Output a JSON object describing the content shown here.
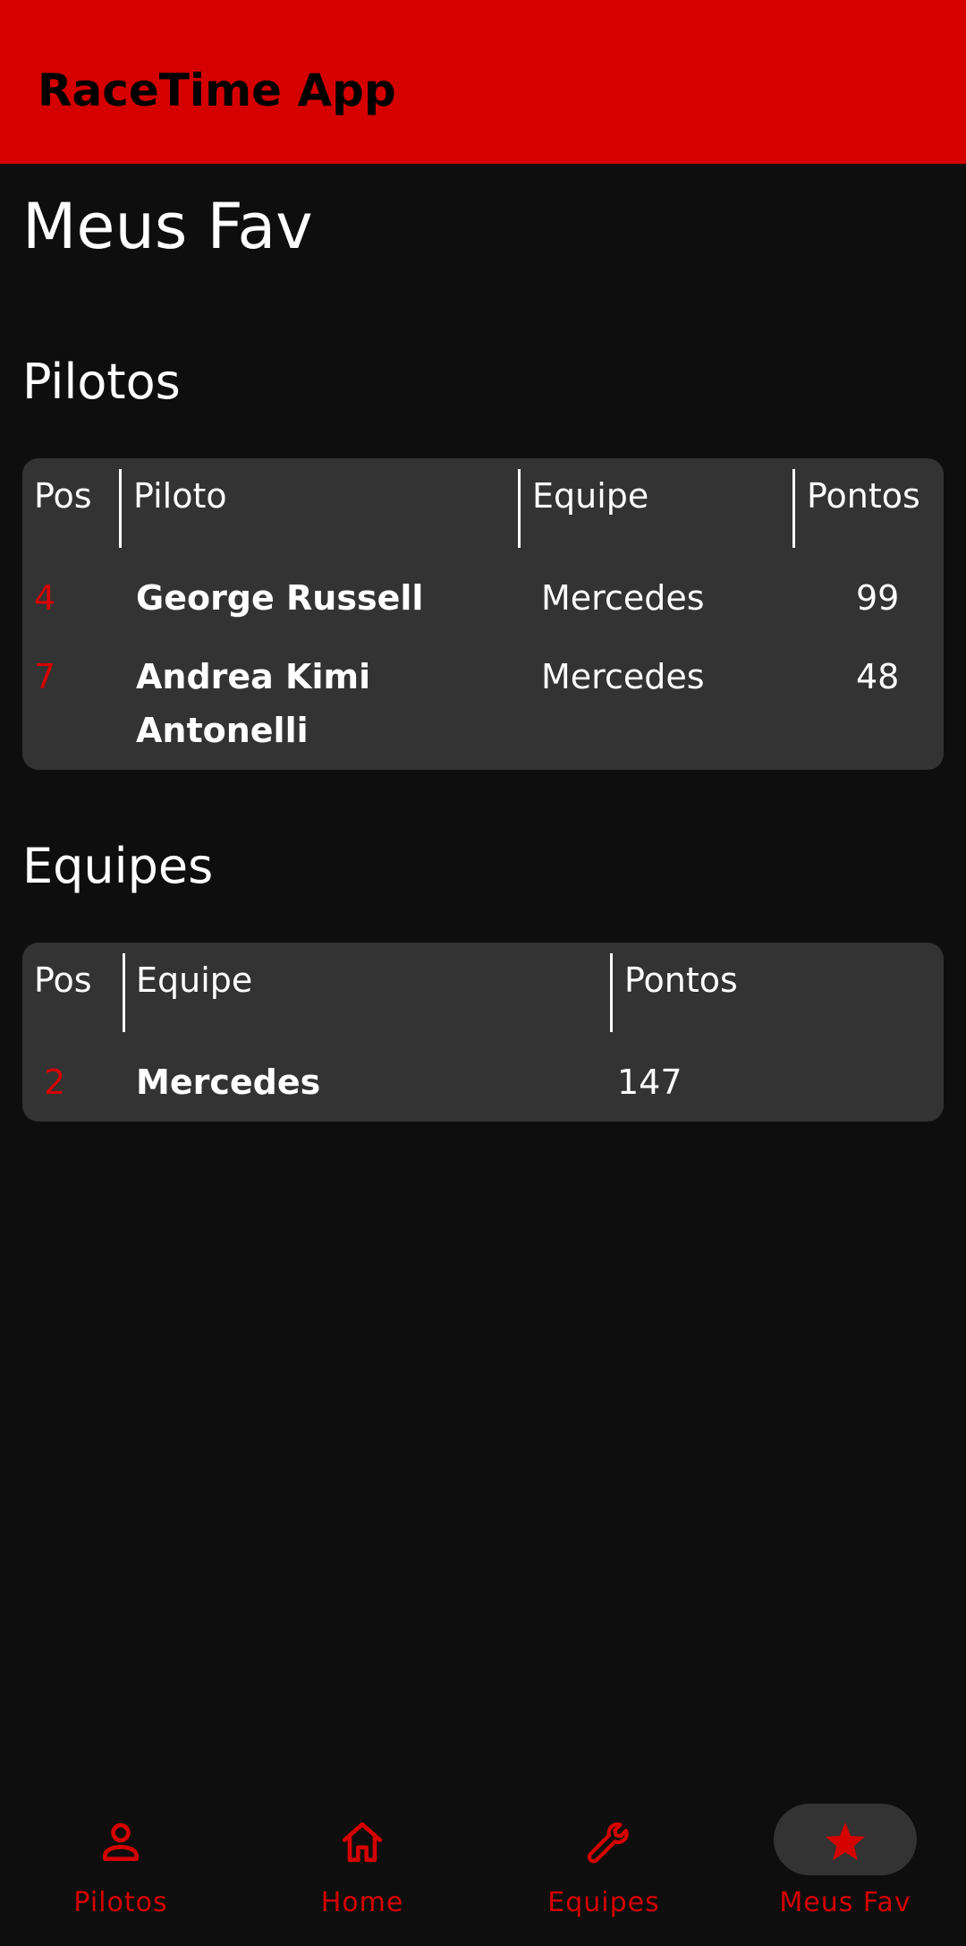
{
  "app": {
    "title": "RaceTime App"
  },
  "page": {
    "title": "Meus Fav"
  },
  "pilotos": {
    "section_title": "Pilotos",
    "headers": {
      "pos": "Pos",
      "piloto": "Piloto",
      "equipe": "Equipe",
      "pontos": "Pontos"
    },
    "rows": [
      {
        "pos": "4",
        "name_line1": "George Russell",
        "name_line2": "",
        "equipe": "Mercedes",
        "pontos": "99"
      },
      {
        "pos": "7",
        "name_line1": "Andrea Kimi",
        "name_line2": "Antonelli",
        "equipe": "Mercedes",
        "pontos": "48"
      }
    ]
  },
  "equipes": {
    "section_title": "Equipes",
    "headers": {
      "pos": "Pos",
      "equipe": "Equipe",
      "pontos": "Pontos"
    },
    "rows": [
      {
        "pos": "2",
        "equipe": "Mercedes",
        "pontos": "147"
      }
    ]
  },
  "nav": {
    "items": [
      {
        "label": "Pilotos",
        "icon": "person-icon"
      },
      {
        "label": "Home",
        "icon": "home-icon"
      },
      {
        "label": "Equipes",
        "icon": "wrench-icon"
      },
      {
        "label": "Meus Fav",
        "icon": "star-icon",
        "active": true
      }
    ]
  },
  "colors": {
    "accent": "#d50000",
    "background": "#0e0e0e",
    "card": "#333333"
  }
}
